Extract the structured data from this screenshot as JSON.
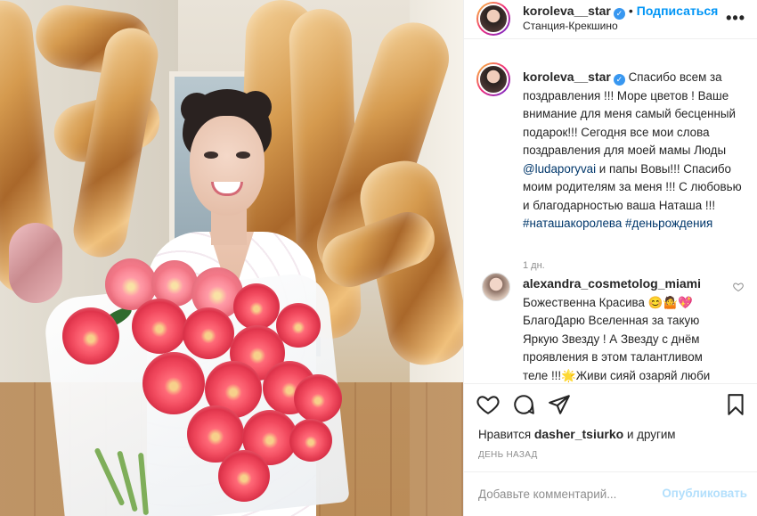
{
  "header": {
    "username": "koroleva__star",
    "separator": "•",
    "follow_label": "Подписаться",
    "location": "Станция-Крекшино",
    "more_icon": "more-horizontal-icon"
  },
  "caption": {
    "username": "koroleva__star",
    "text_1": "Спасибо всем за поздравления !!! Море цветов ! Ваше внимание для меня самый бесценный подарок!!! Сегодня все мои слова поздравления для моей мамы Люды ",
    "mention": "@ludaporyvai",
    "text_2": " и папы Вовы!!! Спасибо моим родителям за меня !!! С любовью и благодарностью ваша Наташа !!! ",
    "hashtags": "#наташакоролева #деньрождения",
    "time": "1 дн."
  },
  "comment": {
    "username": "alexandra_cosmetolog_miami",
    "text": "Божественна Красива 😊🤷💖 БлагоДарю Вселенная за такую Яркую Звезду ! А Звезду с днём проявления в этом талантливом теле !!!🌟Живи сияй озаряй люби"
  },
  "actions": {
    "like_icon": "heart-icon",
    "comment_icon": "comment-icon",
    "share_icon": "share-icon",
    "save_icon": "bookmark-icon"
  },
  "likes": {
    "prefix": "Нравится",
    "user": "dasher_tsiurko",
    "suffix": "и другим"
  },
  "date_label": "ДЕНЬ НАЗАД",
  "comment_input": {
    "placeholder": "Добавьте комментарий...",
    "publish_label": "Опубликовать"
  },
  "colors": {
    "link": "#0095f6",
    "publish_disabled": "#b2dffc",
    "secondary_text": "#8e8e8e",
    "hashtag": "#00376b"
  }
}
